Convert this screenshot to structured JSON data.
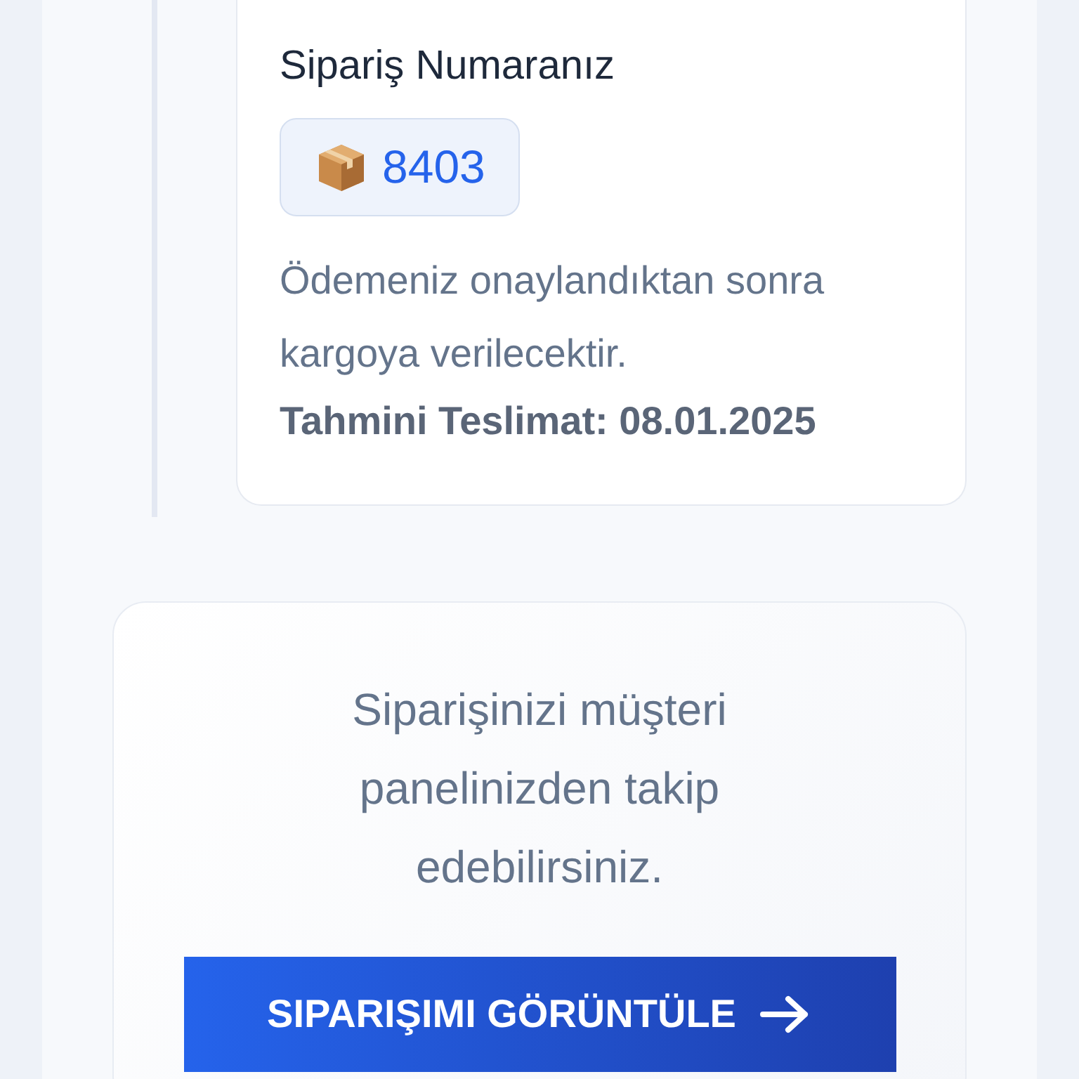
{
  "delivery_card": {
    "order_label": "Sipariş Numaranız",
    "order_number": "8403",
    "note": "Ödemeniz onaylandıktan sonra kargoya verilecektir.",
    "estimate": "Tahmini Teslimat: 08.01.2025"
  },
  "tracking_card": {
    "message": "Siparişinizi müşteri panelinizden takip edebilirsiniz.",
    "button": "SIPARIŞIMI GÖRÜNTÜLE"
  }
}
